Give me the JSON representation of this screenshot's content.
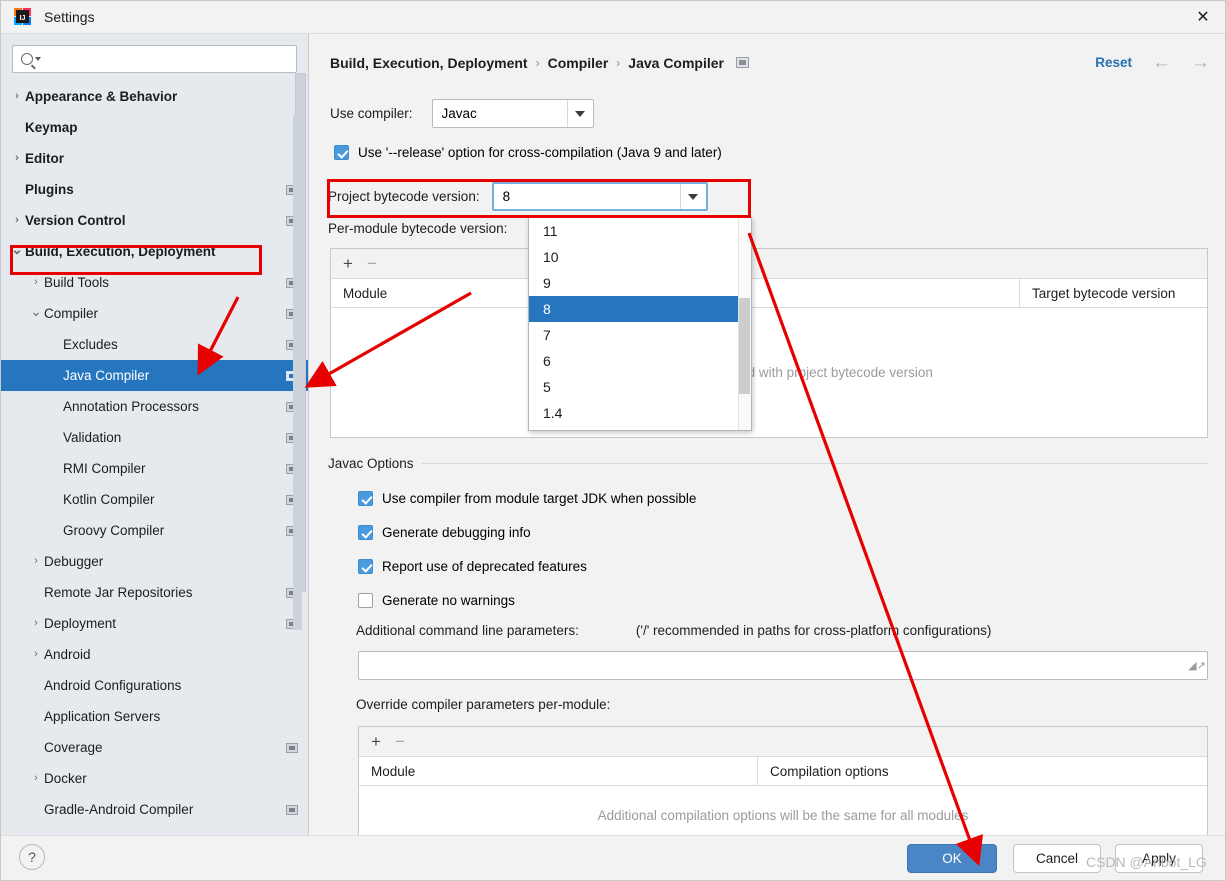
{
  "window": {
    "title": "Settings",
    "app_icon": "intellij-idea-icon",
    "close_icon": "close-icon"
  },
  "sidebar": {
    "search": {
      "placeholder": "",
      "value": "",
      "icon": "search-icon"
    },
    "items": [
      {
        "label": "Appearance & Behavior",
        "twisty": "›",
        "indent": 0,
        "bold": true,
        "badge": false,
        "selected": false
      },
      {
        "label": "Keymap",
        "twisty": "",
        "indent": 0,
        "bold": true,
        "badge": false,
        "selected": false
      },
      {
        "label": "Editor",
        "twisty": "›",
        "indent": 0,
        "bold": true,
        "badge": false,
        "selected": false
      },
      {
        "label": "Plugins",
        "twisty": "",
        "indent": 0,
        "bold": true,
        "badge": true,
        "selected": false
      },
      {
        "label": "Version Control",
        "twisty": "›",
        "indent": 0,
        "bold": true,
        "badge": true,
        "selected": false
      },
      {
        "label": "Build, Execution, Deployment",
        "twisty": "⌄",
        "indent": 0,
        "bold": true,
        "badge": false,
        "selected": false
      },
      {
        "label": "Build Tools",
        "twisty": "›",
        "indent": 1,
        "bold": false,
        "badge": true,
        "selected": false
      },
      {
        "label": "Compiler",
        "twisty": "⌄",
        "indent": 1,
        "bold": false,
        "badge": true,
        "selected": false
      },
      {
        "label": "Excludes",
        "twisty": "",
        "indent": 2,
        "bold": false,
        "badge": true,
        "selected": false
      },
      {
        "label": "Java Compiler",
        "twisty": "",
        "indent": 2,
        "bold": false,
        "badge": true,
        "selected": true
      },
      {
        "label": "Annotation Processors",
        "twisty": "",
        "indent": 2,
        "bold": false,
        "badge": true,
        "selected": false
      },
      {
        "label": "Validation",
        "twisty": "",
        "indent": 2,
        "bold": false,
        "badge": true,
        "selected": false
      },
      {
        "label": "RMI Compiler",
        "twisty": "",
        "indent": 2,
        "bold": false,
        "badge": true,
        "selected": false
      },
      {
        "label": "Kotlin Compiler",
        "twisty": "",
        "indent": 2,
        "bold": false,
        "badge": true,
        "selected": false
      },
      {
        "label": "Groovy Compiler",
        "twisty": "",
        "indent": 2,
        "bold": false,
        "badge": true,
        "selected": false
      },
      {
        "label": "Debugger",
        "twisty": "›",
        "indent": 1,
        "bold": false,
        "badge": false,
        "selected": false
      },
      {
        "label": "Remote Jar Repositories",
        "twisty": "",
        "indent": 1,
        "bold": false,
        "badge": true,
        "selected": false
      },
      {
        "label": "Deployment",
        "twisty": "›",
        "indent": 1,
        "bold": false,
        "badge": true,
        "selected": false
      },
      {
        "label": "Android",
        "twisty": "›",
        "indent": 1,
        "bold": false,
        "badge": false,
        "selected": false
      },
      {
        "label": "Android Configurations",
        "twisty": "",
        "indent": 1,
        "bold": false,
        "badge": false,
        "selected": false
      },
      {
        "label": "Application Servers",
        "twisty": "",
        "indent": 1,
        "bold": false,
        "badge": false,
        "selected": false
      },
      {
        "label": "Coverage",
        "twisty": "",
        "indent": 1,
        "bold": false,
        "badge": true,
        "selected": false
      },
      {
        "label": "Docker",
        "twisty": "›",
        "indent": 1,
        "bold": false,
        "badge": false,
        "selected": false
      },
      {
        "label": "Gradle-Android Compiler",
        "twisty": "",
        "indent": 1,
        "bold": false,
        "badge": true,
        "selected": false
      }
    ]
  },
  "header": {
    "breadcrumb": [
      "Build, Execution, Deployment",
      "Compiler",
      "Java Compiler"
    ],
    "separator": "›",
    "badge_icon": "module-scope-icon",
    "reset_label": "Reset",
    "back_icon": "arrow-left-icon",
    "forward_icon": "arrow-right-icon"
  },
  "main": {
    "use_compiler_label": "Use compiler:",
    "use_compiler_value": "Javac",
    "release_option_label": "Use '--release' option for cross-compilation (Java 9 and later)",
    "release_option_checked": true,
    "project_bytecode_label": "Project bytecode version:",
    "project_bytecode_value": "8",
    "per_module_label": "Per-module bytecode version:",
    "per_module_table": {
      "toolbar": {
        "add": "+",
        "remove": "−"
      },
      "columns": [
        "Module",
        "Target bytecode version"
      ],
      "empty_text": "Modules will be compiled with project bytecode version"
    },
    "javac_group_title": "Javac Options",
    "javac_options": [
      {
        "label": "Use compiler from module target JDK when possible",
        "checked": true
      },
      {
        "label": "Generate debugging info",
        "checked": true
      },
      {
        "label": "Report use of deprecated features",
        "checked": true
      },
      {
        "label": "Generate no warnings",
        "checked": false
      }
    ],
    "additional_params_label": "Additional command line parameters:",
    "additional_params_hint": "('/' recommended in paths for cross-platform configurations)",
    "additional_params_value": "",
    "expand_icon": "expand-editor-icon",
    "override_label": "Override compiler parameters per-module:",
    "override_table": {
      "toolbar": {
        "add": "+",
        "remove": "−"
      },
      "columns": [
        "Module",
        "Compilation options"
      ],
      "empty_text": "Additional compilation options will be the same for all modules"
    }
  },
  "dropdown": {
    "open": true,
    "options": [
      "11",
      "10",
      "9",
      "8",
      "7",
      "6",
      "5",
      "1.4"
    ],
    "selected": "8"
  },
  "footer": {
    "help_label": "?",
    "ok_label": "OK",
    "cancel_label": "Cancel",
    "apply_label": "Apply"
  },
  "watermark": {
    "text": "CSDN @Anbot_LG"
  },
  "colors": {
    "accent_selection": "#2675bf",
    "link": "#2470b3",
    "annotation": "#e60000",
    "checkbox": "#4a9ae0",
    "ok_button": "#4a86c5",
    "sidebar_bg": "#e6eaef"
  }
}
